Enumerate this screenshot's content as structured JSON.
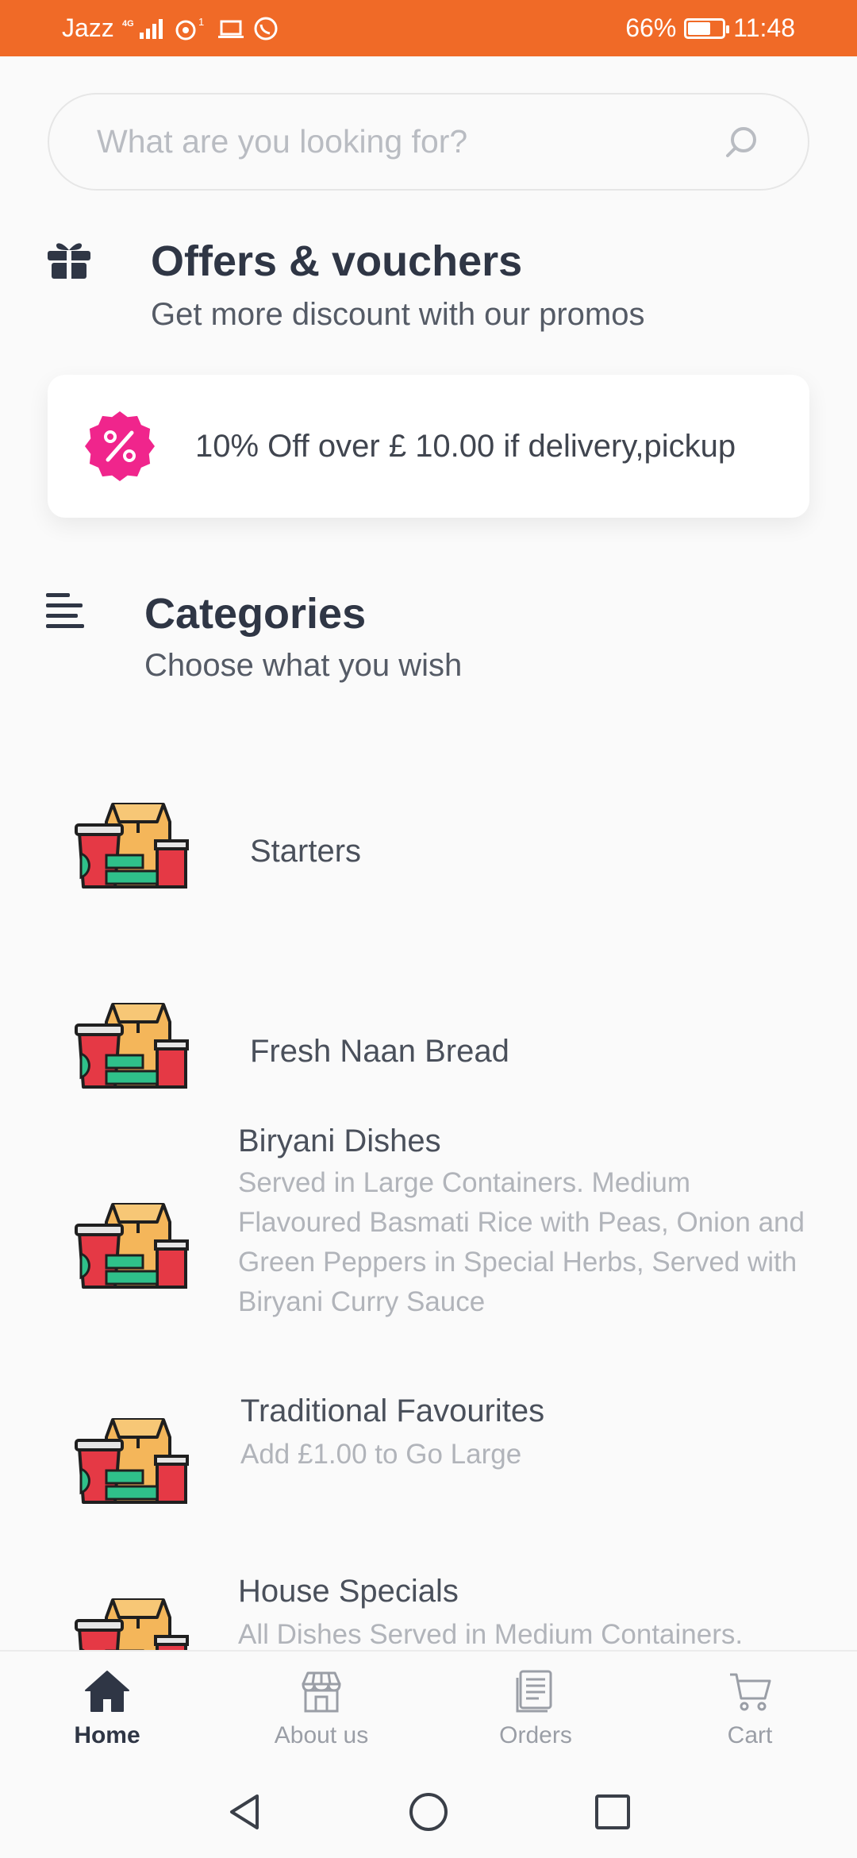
{
  "status_bar": {
    "carrier": "Jazz",
    "network": "4G",
    "sim_number": "1",
    "battery": "66%",
    "battery_level": 0.66,
    "time": "11:48",
    "background": "#f06a27"
  },
  "search": {
    "placeholder": "What are you looking for?"
  },
  "offers": {
    "title": "Offers & vouchers",
    "subtitle": "Get more discount with our promos",
    "card_text": "10% Off over £ 10.00 if delivery,pickup",
    "badge_color": "#f0258c"
  },
  "categories": {
    "title": "Categories",
    "subtitle": "Choose what you wish",
    "items": [
      {
        "name": "Starters",
        "description": ""
      },
      {
        "name": "Fresh Naan Bread",
        "description": ""
      },
      {
        "name": "Biryani Dishes",
        "description": "Served in Large Containers. Medium Flavoured Basmati Rice with Peas, Onion and Green Peppers in Special Herbs, Served with Biryani Curry Sauce"
      },
      {
        "name": "Traditional Favourites",
        "description": "Add £1.00 to Go Large"
      },
      {
        "name": "House Specials",
        "description": "All Dishes Served in Medium Containers."
      }
    ]
  },
  "bottom_nav": {
    "items": [
      {
        "label": "Home",
        "icon": "home-icon",
        "active": true
      },
      {
        "label": "About us",
        "icon": "store-icon",
        "active": false
      },
      {
        "label": "Orders",
        "icon": "receipt-icon",
        "active": false
      },
      {
        "label": "Cart",
        "icon": "cart-icon",
        "active": false
      }
    ]
  }
}
